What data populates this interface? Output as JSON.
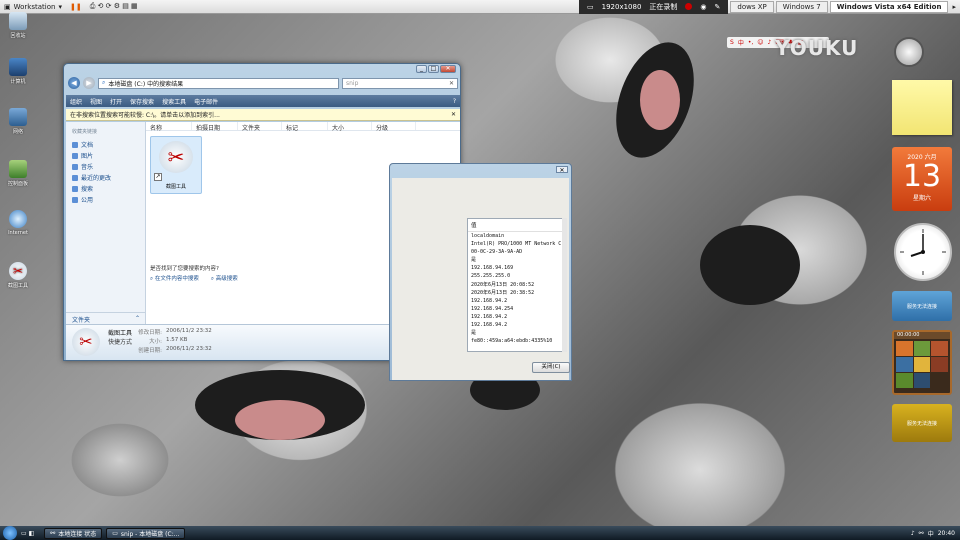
{
  "vmbar": {
    "vm_name": "Workstation",
    "resolution": "1920x1080",
    "recording_status": "正在录制",
    "tabs": [
      "dows XP",
      "Windows 7",
      "Windows Vista x64 Edition"
    ]
  },
  "explorer": {
    "address": "本地磁盘 (C:) 中的搜索结果",
    "search_value": "snip",
    "commands": [
      "组织",
      "视图",
      "打开",
      "保存搜索",
      "搜索工具",
      "电子邮件"
    ],
    "info_message": "在非搜索位置搜索可能较慢: C:\\。请单击以添加到索引...",
    "nav_header": "收藏夹链接",
    "nav_links": [
      "文档",
      "图片",
      "音乐",
      "最近的更改",
      "搜索",
      "公用"
    ],
    "folders_label": "文件夹",
    "columns": [
      "名称",
      "拍摄日期",
      "文件夹",
      "标记",
      "大小",
      "分级"
    ],
    "file_label": "截图工具",
    "not_found_text": "是否找到了您要搜索的内容?",
    "search_links": [
      "在文件内容中搜索",
      "高级搜索"
    ],
    "details": {
      "name": "截图工具",
      "type": "快捷方式",
      "rows": [
        {
          "key": "修改日期:",
          "value": "2006/11/2 23:32"
        },
        {
          "key": "大小:",
          "value": "1.57 KB"
        },
        {
          "key": "创建日期:",
          "value": "2006/11/2 23:32"
        }
      ]
    }
  },
  "netdialog": {
    "column_header": "值",
    "values": [
      "localdomain",
      "Intel(R) PRO/1000 MT Network C",
      "00-0C-29-3A-9A-AD",
      "是",
      "192.168.94.169",
      "255.255.255.0",
      "2020年6月13日 20:08:52",
      "2020年6月13日 20:38:52",
      "192.168.94.2",
      "192.168.94.254",
      "192.168.94.2",
      "192.168.94.2",
      "是",
      "fe80::459a:a64:ebdb:4335%10"
    ],
    "close_button": "关闭(C)"
  },
  "gadgets": {
    "brand": "YOUKU",
    "calendar": {
      "month": "2020 六月",
      "day": "13",
      "weekday": "星期六"
    },
    "weather_1": "服务无法连接",
    "puzzle_title": "00:00:00",
    "weather_2": "服务无法连接"
  },
  "taskbar": {
    "buttons": [
      "本地连接 状态",
      "snip - 本地磁盘 (C:..."
    ],
    "time": "20:40"
  },
  "desktop_icons": [
    "回收站",
    "计算机",
    "网络",
    "控制面板",
    "Internet",
    "截图工具"
  ]
}
